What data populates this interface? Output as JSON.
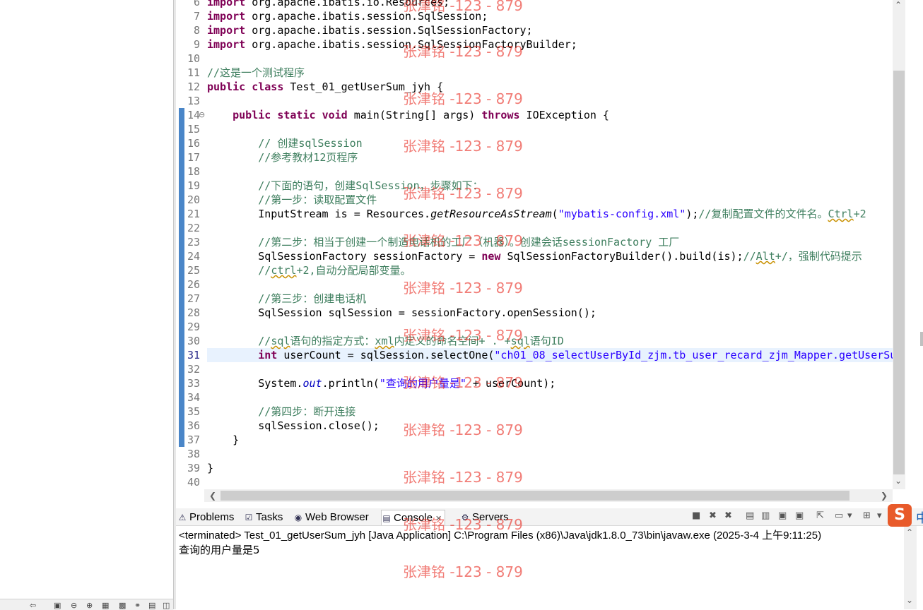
{
  "code_lines": [
    {
      "n": "6",
      "parts": [
        {
          "t": "import",
          "c": "kw"
        },
        {
          "t": " org.apache.ibatis.io.Resources;"
        }
      ]
    },
    {
      "n": "7",
      "parts": [
        {
          "t": "import",
          "c": "kw"
        },
        {
          "t": " org.apache.ibatis.session.SqlSession;"
        }
      ]
    },
    {
      "n": "8",
      "parts": [
        {
          "t": "import",
          "c": "kw"
        },
        {
          "t": " org.apache.ibatis.session.SqlSessionFactory;"
        }
      ]
    },
    {
      "n": "9",
      "parts": [
        {
          "t": "import",
          "c": "kw"
        },
        {
          "t": " org.apache.ibatis.session.SqlSessionFactoryBuilder;"
        }
      ]
    },
    {
      "n": "10",
      "parts": []
    },
    {
      "n": "11",
      "parts": [
        {
          "t": "//这是一个测试程序",
          "c": "cm"
        }
      ]
    },
    {
      "n": "12",
      "parts": [
        {
          "t": "public",
          "c": "kw"
        },
        {
          "t": " "
        },
        {
          "t": "class",
          "c": "kw"
        },
        {
          "t": " Test_01_getUserSum_jyh {"
        }
      ]
    },
    {
      "n": "13",
      "parts": []
    },
    {
      "n": "14",
      "parts": [
        {
          "t": "    "
        },
        {
          "t": "public",
          "c": "kw"
        },
        {
          "t": " "
        },
        {
          "t": "static",
          "c": "kw"
        },
        {
          "t": " "
        },
        {
          "t": "void",
          "c": "kw"
        },
        {
          "t": " main(String[] args) "
        },
        {
          "t": "throws",
          "c": "kw"
        },
        {
          "t": " IOException {"
        }
      ]
    },
    {
      "n": "15",
      "parts": []
    },
    {
      "n": "16",
      "parts": [
        {
          "t": "        "
        },
        {
          "t": "// 创建sqlSession",
          "c": "cm"
        }
      ]
    },
    {
      "n": "17",
      "parts": [
        {
          "t": "        "
        },
        {
          "t": "//参考教材12页程序",
          "c": "cm"
        }
      ]
    },
    {
      "n": "18",
      "parts": []
    },
    {
      "n": "19",
      "parts": [
        {
          "t": "        "
        },
        {
          "t": "//下面的语句，创建SqlSession，步骤如下：",
          "c": "cm"
        }
      ]
    },
    {
      "n": "20",
      "parts": [
        {
          "t": "        "
        },
        {
          "t": "//第一步：读取配置文件",
          "c": "cm"
        }
      ]
    },
    {
      "n": "21",
      "parts": [
        {
          "t": "        InputStream is = Resources."
        },
        {
          "t": "getResourceAsStream",
          "c": "it"
        },
        {
          "t": "("
        },
        {
          "t": "\"mybatis-config.xml\"",
          "c": "st"
        },
        {
          "t": ");"
        },
        {
          "t": "//复制配置文件的文件名。",
          "c": "cm"
        },
        {
          "t": "Ctrl",
          "c": "cm uline"
        },
        {
          "t": "+2",
          "c": "cm"
        }
      ]
    },
    {
      "n": "22",
      "parts": []
    },
    {
      "n": "23",
      "parts": [
        {
          "t": "        "
        },
        {
          "t": "//第二步：相当于创建一个制造电话机的工厂（机器）。创建会话sessionFactory 工厂",
          "c": "cm"
        }
      ]
    },
    {
      "n": "24",
      "parts": [
        {
          "t": "        SqlSessionFactory sessionFactory = "
        },
        {
          "t": "new",
          "c": "kw"
        },
        {
          "t": " SqlSessionFactoryBuilder().build(is);"
        },
        {
          "t": "//",
          "c": "cm"
        },
        {
          "t": "Alt",
          "c": "cm uline"
        },
        {
          "t": "+/，强制代码提示",
          "c": "cm"
        }
      ]
    },
    {
      "n": "25",
      "parts": [
        {
          "t": "        "
        },
        {
          "t": "//",
          "c": "cm"
        },
        {
          "t": "ctrl",
          "c": "cm uline"
        },
        {
          "t": "+2,自动分配局部变量。",
          "c": "cm"
        }
      ]
    },
    {
      "n": "26",
      "parts": []
    },
    {
      "n": "27",
      "parts": [
        {
          "t": "        "
        },
        {
          "t": "//第三步：创建电话机",
          "c": "cm"
        }
      ]
    },
    {
      "n": "28",
      "parts": [
        {
          "t": "        SqlSession sqlSession = sessionFactory.openSession();"
        }
      ]
    },
    {
      "n": "29",
      "parts": []
    },
    {
      "n": "30",
      "parts": [
        {
          "t": "        "
        },
        {
          "t": "//",
          "c": "cm"
        },
        {
          "t": "sql",
          "c": "cm uline"
        },
        {
          "t": "语句的指定方式：",
          "c": "cm"
        },
        {
          "t": "xml",
          "c": "cm uline"
        },
        {
          "t": "内定义的命名空间+ . +",
          "c": "cm"
        },
        {
          "t": "sql",
          "c": "cm uline"
        },
        {
          "t": "语句ID",
          "c": "cm"
        }
      ]
    },
    {
      "n": "31",
      "parts": [
        {
          "t": "        "
        },
        {
          "t": "int",
          "c": "kw"
        },
        {
          "t": " userCount = sqlSession.selectOne("
        },
        {
          "t": "\"ch01_08_selectUserById_zjm.tb_user_recard_zjm_Mapper.getUserSu",
          "c": "st"
        }
      ]
    },
    {
      "n": "32",
      "parts": []
    },
    {
      "n": "33",
      "parts": [
        {
          "t": "        System."
        },
        {
          "t": "out",
          "c": "fld"
        },
        {
          "t": ".println("
        },
        {
          "t": "\"查询的用户量是\"",
          "c": "st"
        },
        {
          "t": " + userCount);"
        }
      ]
    },
    {
      "n": "34",
      "parts": []
    },
    {
      "n": "35",
      "parts": [
        {
          "t": "        "
        },
        {
          "t": "//第四步：断开连接",
          "c": "cm"
        }
      ]
    },
    {
      "n": "36",
      "parts": [
        {
          "t": "        sqlSession.close();"
        }
      ]
    },
    {
      "n": "37",
      "parts": [
        {
          "t": "    }"
        }
      ]
    },
    {
      "n": "38",
      "parts": []
    },
    {
      "n": "39",
      "parts": [
        {
          "t": "}"
        }
      ]
    },
    {
      "n": "40",
      "parts": []
    }
  ],
  "tabs": [
    {
      "label": "Problems",
      "icon": "problems-icon",
      "glyph": "⚠"
    },
    {
      "label": "Tasks",
      "icon": "tasks-icon",
      "glyph": "☑"
    },
    {
      "label": "Web Browser",
      "icon": "globe-icon",
      "glyph": "◉"
    },
    {
      "label": "Console",
      "icon": "console-icon",
      "glyph": "▤",
      "active": true
    },
    {
      "label": "Servers",
      "icon": "servers-icon",
      "glyph": "⚙"
    }
  ],
  "console": {
    "header": "<terminated> Test_01_getUserSum_jyh [Java Application] C:\\Program Files (x86)\\Java\\jdk1.8.0_73\\bin\\javaw.exe (2025-3-4 上午9:11:25)",
    "output": "查询的用户量是5"
  },
  "watermark": "张津铭 -123 - 879",
  "logo_text": "S",
  "logo_extra": "中",
  "colors": {
    "keyword": "#7f0055",
    "comment": "#3f7f5f",
    "string": "#2a00ff",
    "line_number": "#787878",
    "watermark": "#e8281e"
  }
}
